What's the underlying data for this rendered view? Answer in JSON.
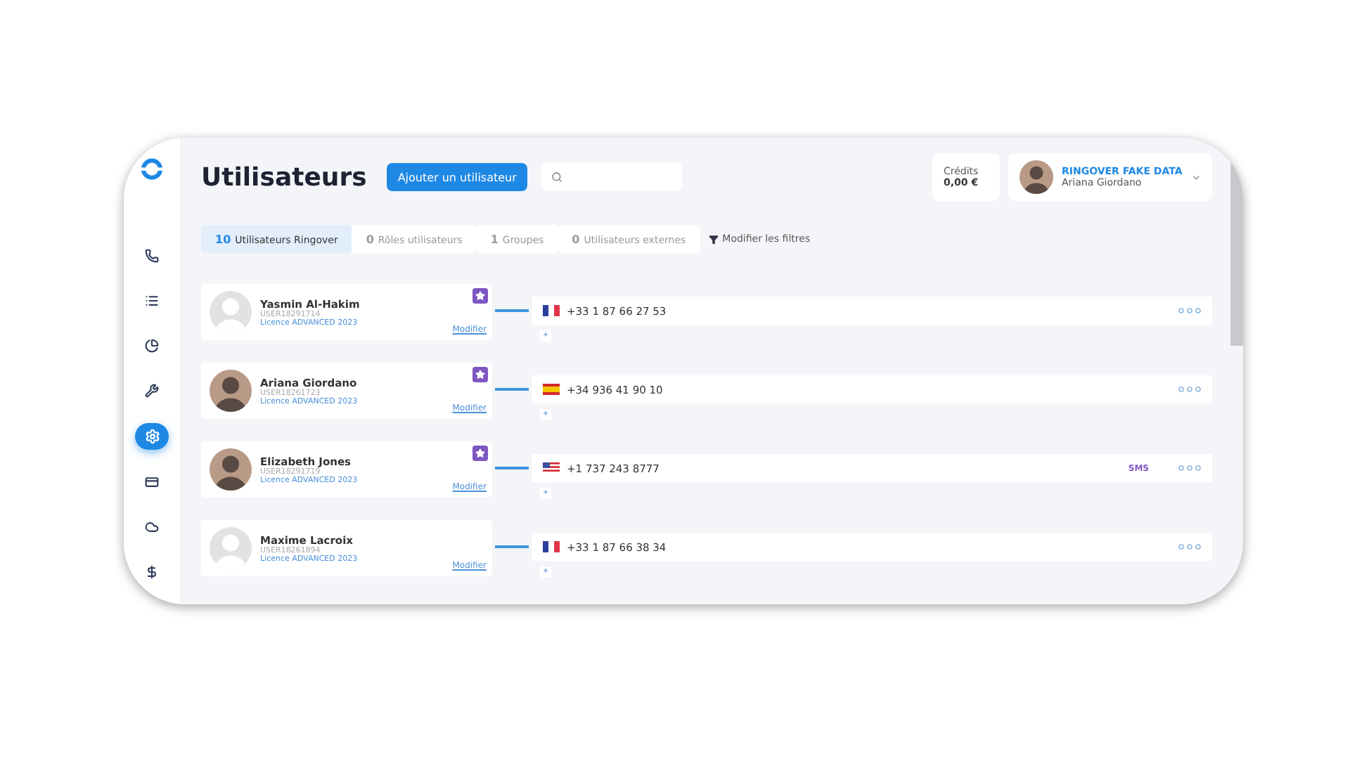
{
  "sidebar": {
    "items": [
      {
        "selected": false
      },
      {
        "selected": false
      },
      {
        "selected": false
      },
      {
        "selected": false
      },
      {
        "selected": true
      },
      {
        "selected": false
      },
      {
        "selected": false
      },
      {
        "selected": false
      }
    ]
  },
  "header": {
    "title": "Utilisateurs",
    "add_button": "Ajouter un utilisateur",
    "credits": {
      "label": "Crédits",
      "value": "0,00 €"
    },
    "account": {
      "company": "RINGOVER FAKE DATA",
      "user": "Ariana Giordano"
    }
  },
  "tabs": [
    {
      "count": "10",
      "label": "Utilisateurs Ringover",
      "selected": true
    },
    {
      "count": "0",
      "label": "Rôles utilisateurs",
      "selected": false
    },
    {
      "count": "1",
      "label": "Groupes",
      "selected": false
    },
    {
      "count": "0",
      "label": "Utilisateurs externes",
      "selected": false
    }
  ],
  "filter_button": "Modifier les filtres",
  "users": [
    {
      "name": "Yasmin Al-Hakim",
      "id": "USER18291714",
      "license": "Licence ADVANCED 2023",
      "edit": "Modifier",
      "starred": true,
      "avatar": {
        "kind": "placeholder"
      },
      "phone": {
        "kind": "fr",
        "number": "+33 1 87 66 27 53"
      },
      "add": "+"
    },
    {
      "name": "Ariana Giordano",
      "id": "USER18261723",
      "license": "Licence ADVANCED 2023",
      "edit": "Modifier",
      "starred": true,
      "avatar": {
        "kind": "photo"
      },
      "phone": {
        "kind": "es",
        "number": "+34 936 41 90 10"
      },
      "add": "+"
    },
    {
      "name": "Elizabeth Jones",
      "id": "USER18291719",
      "license": "Licence ADVANCED 2023",
      "edit": "Modifier",
      "starred": true,
      "avatar": {
        "kind": "photo"
      },
      "phone": {
        "kind": "us",
        "number": "+1 737 243 8777",
        "sms": "SMS"
      },
      "add": "+"
    },
    {
      "name": "Maxime Lacroix",
      "id": "USER18261894",
      "license": "Licence ADVANCED 2023",
      "edit": "Modifier",
      "starred": false,
      "avatar": {
        "kind": "placeholder"
      },
      "phone": {
        "kind": "fr",
        "number": "+33 1 87 66 38 34"
      },
      "add": "+"
    }
  ]
}
